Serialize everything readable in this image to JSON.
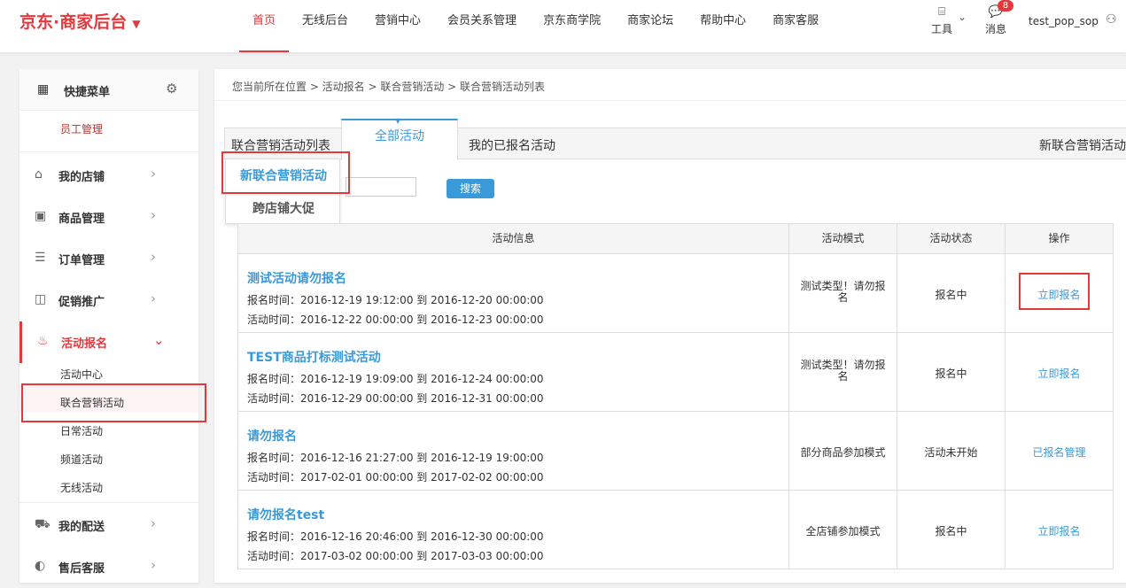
{
  "header": {
    "logo": "京东·商家后台",
    "logo_caret": "▼",
    "nav": [
      "首页",
      "无线后台",
      "营销中心",
      "会员关系管理",
      "京东商学院",
      "商家论坛",
      "帮助中心",
      "商家客服"
    ],
    "tools_label": "工具",
    "messages_label": "消息",
    "messages_badge": "8",
    "username": "test_pop_sop"
  },
  "sidebar": {
    "quick_menu_title": "快捷菜单",
    "quick_items": [
      "员工管理"
    ],
    "menus": [
      {
        "label": "我的店铺",
        "icon": "store-icon"
      },
      {
        "label": "商品管理",
        "icon": "product-icon"
      },
      {
        "label": "订单管理",
        "icon": "order-icon"
      },
      {
        "label": "促销推广",
        "icon": "promotion-icon"
      },
      {
        "label": "活动报名",
        "icon": "activity-icon"
      },
      {
        "label": "我的配送",
        "icon": "delivery-icon"
      },
      {
        "label": "售后客服",
        "icon": "service-icon"
      }
    ],
    "sub_items": [
      "活动中心",
      "联合营销活动",
      "日常活动",
      "频道活动",
      "无线活动"
    ]
  },
  "main": {
    "breadcrumb": "您当前所在位置 > 活动报名 > 联合营销活动 > 联合营销活动列表",
    "tabs": {
      "list": "联合营销活动列表",
      "all": "全部活动",
      "mine": "我的已报名活动",
      "new": "新联合营销活动"
    },
    "dropdown": [
      "新联合营销活动",
      "跨店铺大促"
    ],
    "search_button": "搜索",
    "table": {
      "headers": [
        "活动信息",
        "活动模式",
        "活动状态",
        "操作"
      ],
      "rows": [
        {
          "title": "测试活动请勿报名",
          "signup": "报名时间：2016-12-19 19:12:00  到  2016-12-20 00:00:00",
          "active": "活动时间：2016-12-22 00:00:00  到  2016-12-23 00:00:00",
          "mode": "测试类型！请勿报名",
          "status": "报名中",
          "op": "立即报名"
        },
        {
          "title": "TEST商品打标测试活动",
          "signup": "报名时间：2016-12-19 19:09:00  到  2016-12-24 00:00:00",
          "active": "活动时间：2016-12-29 00:00:00  到  2016-12-31 00:00:00",
          "mode": "测试类型！请勿报名",
          "status": "报名中",
          "op": "立即报名"
        },
        {
          "title": "请勿报名",
          "signup": "报名时间：2016-12-16 21:27:00  到  2016-12-19 19:00:00",
          "active": "活动时间：2017-02-01 00:00:00  到  2017-02-02 00:00:00",
          "mode": "部分商品参加模式",
          "status": "活动未开始",
          "op": "已报名管理"
        },
        {
          "title": "请勿报名test",
          "signup": "报名时间：2016-12-16 20:46:00  到  2016-12-30 00:00:00",
          "active": "活动时间：2017-03-02 00:00:00  到  2017-03-03 00:00:00",
          "mode": "全店铺参加模式",
          "status": "报名中",
          "op": "立即报名"
        }
      ]
    }
  }
}
